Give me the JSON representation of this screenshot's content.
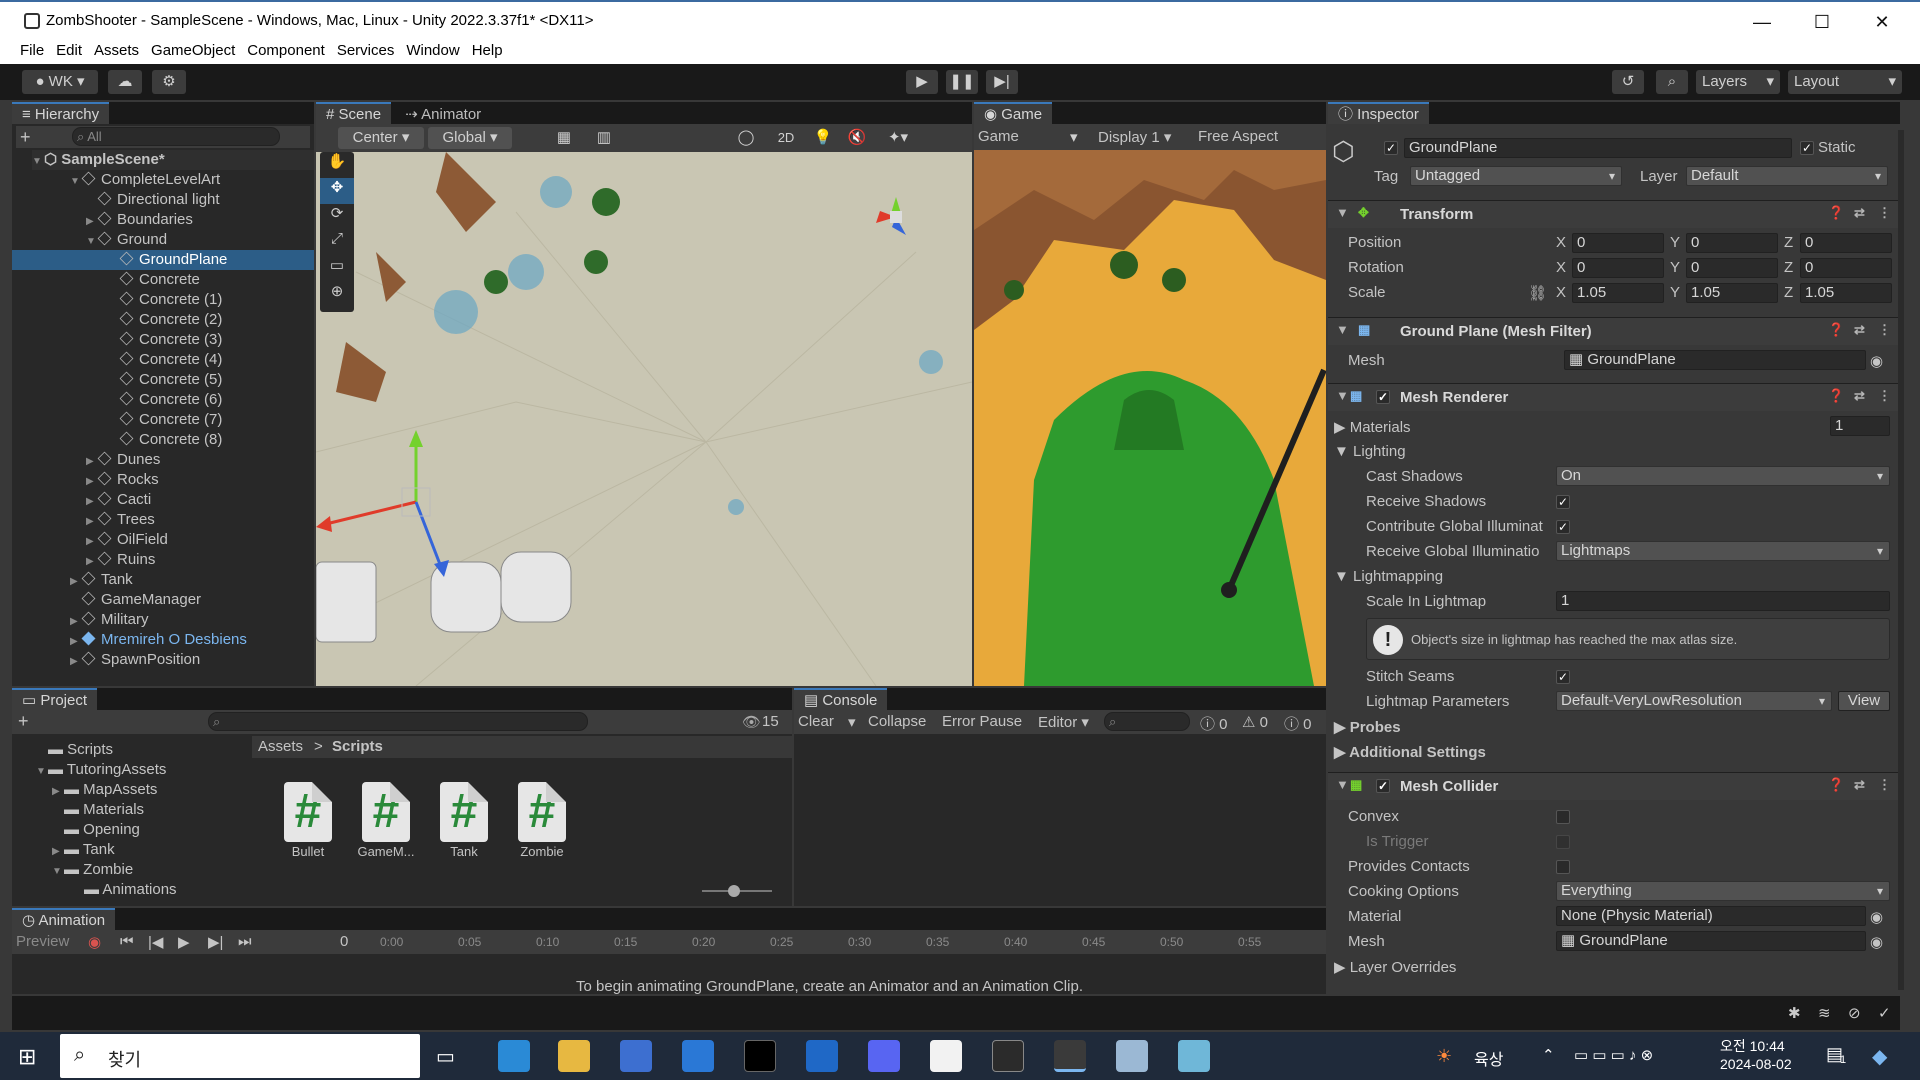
{
  "window": {
    "title": "ZombShooter - SampleScene - Windows, Mac, Linux - Unity 2022.3.37f1* <DX11>",
    "minimize": "—",
    "maximize": "☐",
    "close": "✕"
  },
  "menu": [
    "File",
    "Edit",
    "Assets",
    "GameObject",
    "Component",
    "Services",
    "Window",
    "Help"
  ],
  "toolbar": {
    "account": "WK",
    "layers": "Layers",
    "layout": "Layout"
  },
  "hierarchy": {
    "tab": "Hierarchy",
    "search_placeholder": "All",
    "scene": "SampleScene*",
    "items": [
      {
        "label": "CompleteLevelArt"
      },
      {
        "label": "Directional light"
      },
      {
        "label": "Boundaries"
      },
      {
        "label": "Ground"
      },
      {
        "label": "GroundPlane"
      },
      {
        "label": "Concrete"
      },
      {
        "label": "Concrete (1)"
      },
      {
        "label": "Concrete (2)"
      },
      {
        "label": "Concrete (3)"
      },
      {
        "label": "Concrete (4)"
      },
      {
        "label": "Concrete (5)"
      },
      {
        "label": "Concrete (6)"
      },
      {
        "label": "Concrete (7)"
      },
      {
        "label": "Concrete (8)"
      },
      {
        "label": "Dunes"
      },
      {
        "label": "Rocks"
      },
      {
        "label": "Cacti"
      },
      {
        "label": "Trees"
      },
      {
        "label": "OilField"
      },
      {
        "label": "Ruins"
      },
      {
        "label": "Tank"
      },
      {
        "label": "GameManager"
      },
      {
        "label": "Military"
      },
      {
        "label": "Mremireh O Desbiens"
      },
      {
        "label": "SpawnPosition"
      }
    ]
  },
  "scene": {
    "tab_scene": "Scene",
    "tab_animator": "Animator",
    "pivot": "Center",
    "space": "Global",
    "mode_2d": "2D"
  },
  "game": {
    "tab": "Game",
    "view": "Game",
    "display": "Display 1",
    "aspect": "Free Aspect"
  },
  "inspector": {
    "tab": "Inspector",
    "object_name": "GroundPlane",
    "static_label": "Static",
    "tag_label": "Tag",
    "tag_value": "Untagged",
    "layer_label": "Layer",
    "layer_value": "Default",
    "transform": {
      "title": "Transform",
      "position_label": "Position",
      "rotation_label": "Rotation",
      "scale_label": "Scale",
      "x": "X",
      "y": "Y",
      "z": "Z",
      "position": [
        "0",
        "0",
        "0"
      ],
      "rotation": [
        "0",
        "0",
        "0"
      ],
      "scale": [
        "1.05",
        "1.05",
        "1.05"
      ]
    },
    "mesh_filter": {
      "title": "Ground Plane (Mesh Filter)",
      "mesh_label": "Mesh",
      "mesh_value": "GroundPlane"
    },
    "mesh_renderer": {
      "title": "Mesh Renderer",
      "materials_label": "Materials",
      "materials_count": "1",
      "lighting_label": "Lighting",
      "cast_shadows_label": "Cast Shadows",
      "cast_shadows_value": "On",
      "receive_shadows_label": "Receive Shadows",
      "contribute_gi_label": "Contribute Global Illuminat",
      "receive_gi_label": "Receive Global Illuminatio",
      "receive_gi_value": "Lightmaps",
      "lightmapping_label": "Lightmapping",
      "scale_lightmap_label": "Scale In Lightmap",
      "scale_lightmap_value": "1",
      "warning": "Object's size in lightmap has reached the max atlas size.",
      "stitch_label": "Stitch Seams",
      "lightmap_params_label": "Lightmap Parameters",
      "lightmap_params_value": "Default-VeryLowResolution",
      "view_button": "View",
      "probes_label": "Probes",
      "additional_label": "Additional Settings"
    },
    "mesh_collider": {
      "title": "Mesh Collider",
      "convex_label": "Convex",
      "is_trigger_label": "Is Trigger",
      "provides_contacts_label": "Provides Contacts",
      "cooking_label": "Cooking Options",
      "cooking_value": "Everything",
      "material_label": "Material",
      "material_value": "None (Physic Material)",
      "mesh_label": "Mesh",
      "mesh_value": "GroundPlane",
      "layer_overrides_label": "Layer Overrides"
    }
  },
  "project": {
    "tab": "Project",
    "hidden_count": "15",
    "tree": [
      {
        "label": "Scripts"
      },
      {
        "label": "TutoringAssets"
      },
      {
        "label": "MapAssets"
      },
      {
        "label": "Materials"
      },
      {
        "label": "Opening"
      },
      {
        "label": "Tank"
      },
      {
        "label": "Zombie"
      },
      {
        "label": "Animations"
      }
    ],
    "breadcrumb_root": "Assets",
    "breadcrumb_sep": ">",
    "breadcrumb_current": "Scripts",
    "assets": [
      {
        "label": "Bullet"
      },
      {
        "label": "GameM..."
      },
      {
        "label": "Tank"
      },
      {
        "label": "Zombie"
      }
    ]
  },
  "console": {
    "tab": "Console",
    "clear": "Clear",
    "collapse": "Collapse",
    "error_pause": "Error Pause",
    "editor": "Editor",
    "info_count": "0",
    "warn_count": "0",
    "error_count": "0"
  },
  "animation": {
    "tab": "Animation",
    "preview": "Preview",
    "frame": "0",
    "ticks": [
      "0:00",
      "0:05",
      "0:10",
      "0:15",
      "0:20",
      "0:25",
      "0:30",
      "0:35",
      "0:40",
      "0:45",
      "0:50",
      "0:55"
    ],
    "message": "To begin animating GroundPlane, create an Animator and an Animation Clip."
  },
  "taskbar": {
    "search": "찾기",
    "weather": "육상",
    "time": "오전 10:44",
    "date": "2024-08-02",
    "notifications": "1"
  },
  "colors": {
    "selection": "#2c5d87",
    "tab_accent": "#3a79bb",
    "prefab_blue": "#7bb6ef"
  }
}
